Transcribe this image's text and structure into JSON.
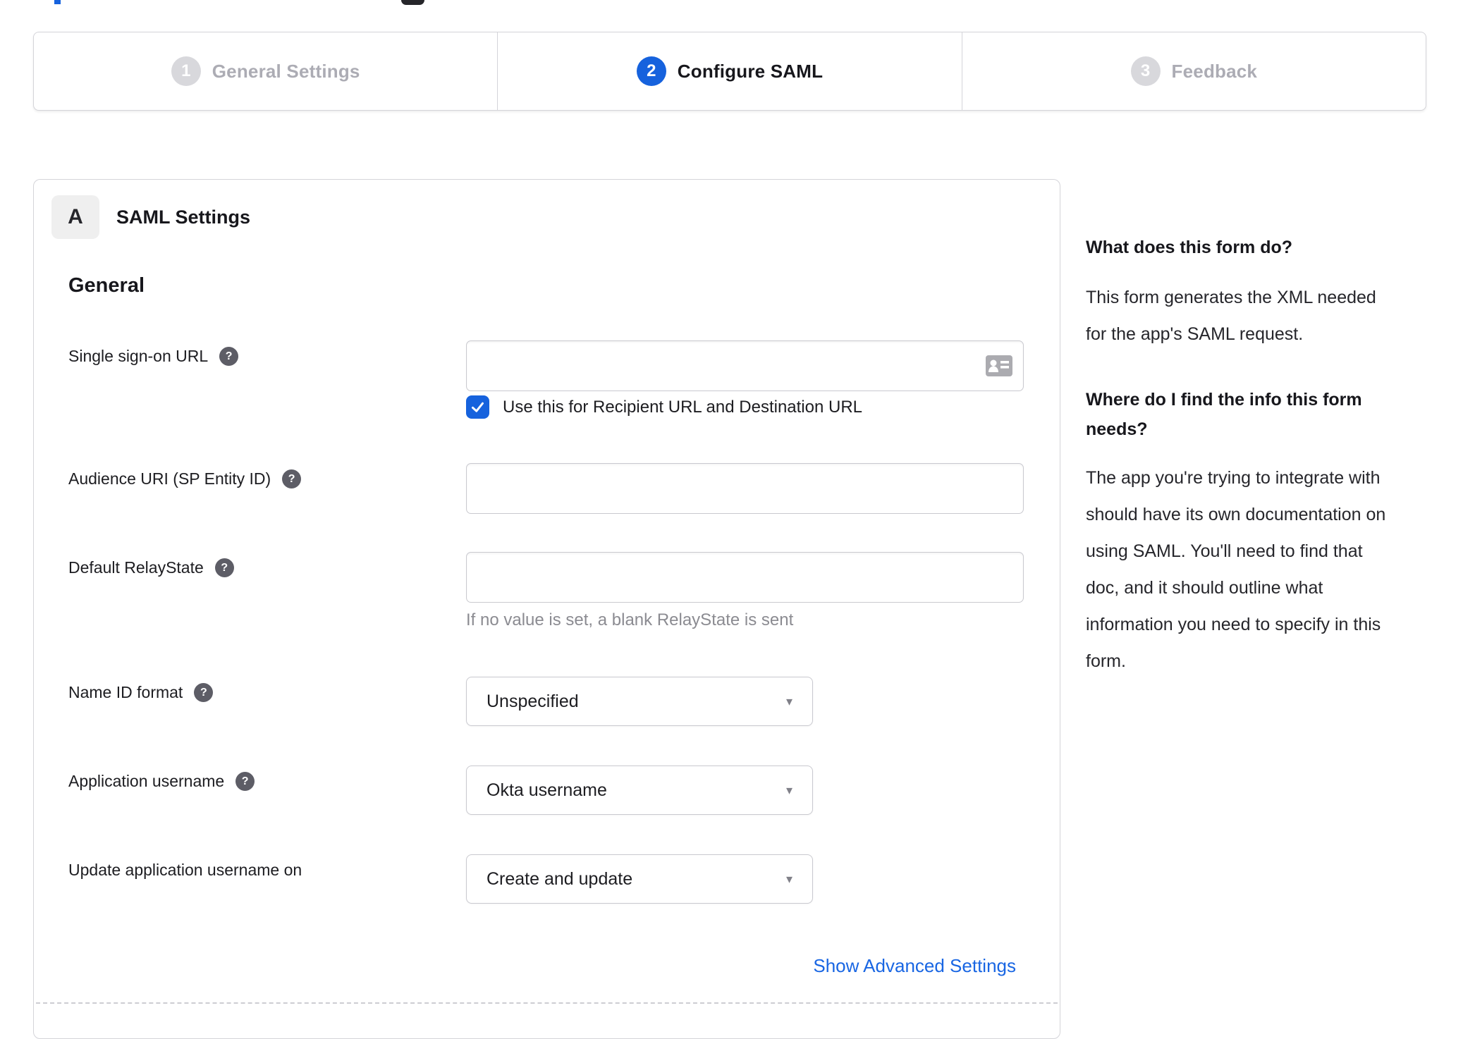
{
  "colors": {
    "accent_blue": "#1662dd",
    "text_dark": "#1d1d21",
    "muted_gray": "#8b8b91",
    "inactive_gray": "#acacb4",
    "border_gray": "#d4d4d9"
  },
  "icons": {
    "help_glyph": "?",
    "check_glyph": "✔",
    "caret_glyph": "▾"
  },
  "stepper": {
    "steps": [
      {
        "number": "1",
        "label": "General Settings",
        "state": "inactive"
      },
      {
        "number": "2",
        "label": "Configure SAML",
        "state": "active"
      },
      {
        "number": "3",
        "label": "Feedback",
        "state": "inactive"
      }
    ]
  },
  "panel": {
    "section_badge": "A",
    "section_title": "SAML Settings",
    "group_heading": "General",
    "fields": {
      "sso": {
        "label": "Single sign-on URL",
        "value": "",
        "checkbox_label": "Use this for Recipient URL and Destination URL",
        "checkbox_checked": true
      },
      "audience": {
        "label": "Audience URI (SP Entity ID)",
        "value": ""
      },
      "relay": {
        "label": "Default RelayState",
        "value": "",
        "hint": "If no value is set, a blank RelayState is sent"
      },
      "nameid": {
        "label": "Name ID format",
        "value": "Unspecified"
      },
      "appuser": {
        "label": "Application username",
        "value": "Okta username"
      },
      "updateuser": {
        "label": "Update application username on",
        "value": "Create and update"
      }
    },
    "advanced_link": "Show Advanced Settings"
  },
  "sidebar": {
    "q1": "What does this form do?",
    "a1_lines": [
      "This form generates the XML needed",
      "for the app's SAML request."
    ],
    "q2_lines": [
      "Where do I find the info this form",
      "needs?"
    ],
    "a2_lines": [
      "The app you're trying to integrate with",
      "should have its own documentation on",
      "using SAML. You'll need to find that",
      "doc, and it should outline what",
      "information you need to specify in this",
      "form."
    ]
  }
}
